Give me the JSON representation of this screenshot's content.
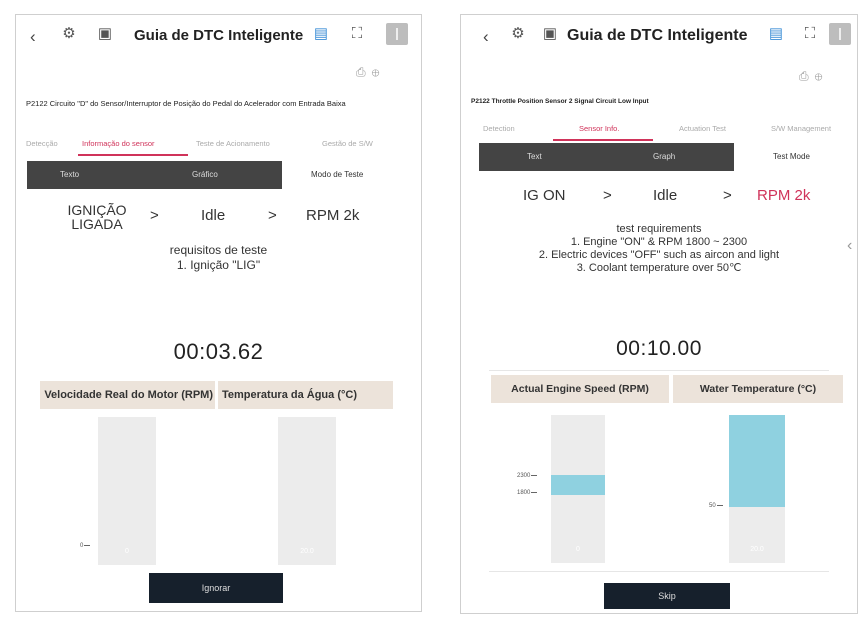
{
  "left": {
    "header": {
      "title": "Guia de DTC Inteligente"
    },
    "dtc_text": "P2122 Circuito \"D\" do Sensor/Interruptor de Posição do Pedal do Acelerador com Entrada Baixa",
    "tabs": [
      "Detecção",
      "Informação do sensor",
      "Teste de Acionamento",
      "Gestão de S/W"
    ],
    "segment": {
      "text": "Texto",
      "graph": "Gráfico",
      "test_mode": "Modo de Teste"
    },
    "steps": [
      "IGNIÇÃO LIGADA",
      ">",
      "Idle",
      ">",
      "RPM 2k"
    ],
    "requirements": {
      "title": "requisitos de teste",
      "lines": [
        "1. Ignição \"LIG\""
      ]
    },
    "timer": "00:03.62",
    "graph_headers": [
      "Velocidade Real do Motor (RPM)",
      "Temperatura da Água (°C)"
    ],
    "graphs": [
      {
        "value_label": "0",
        "tick": "0",
        "fill_fraction": 0
      },
      {
        "value_label": "20.0",
        "fill_fraction": 0
      }
    ],
    "button": "Ignorar"
  },
  "right": {
    "header": {
      "title": "Guia de DTC Inteligente"
    },
    "dtc_text": "P2122 Throttle Position Sensor 2 Signal Circuit Low Input",
    "tabs": [
      "Detection",
      "Sensor Info.",
      "Actuation Test",
      "S/W Management"
    ],
    "segment": {
      "text": "Text",
      "graph": "Graph",
      "test_mode": "Test Mode"
    },
    "steps": [
      "IG ON",
      ">",
      "Idle",
      ">",
      "RPM 2k"
    ],
    "requirements": {
      "title": "test requirements",
      "lines": [
        "1. Engine \"ON\" & RPM 1800 ~ 2300",
        "2. Electric devices \"OFF\" such as aircon and light",
        "3. Coolant temperature over 50℃"
      ]
    },
    "timer": "00:10.00",
    "graph_headers": [
      "Actual Engine Speed (RPM)",
      "Water Temperature (°C)"
    ],
    "graphs": [
      {
        "value_label": "0",
        "ticks": [
          "2300",
          "1800"
        ],
        "band": [
          1800,
          2300
        ]
      },
      {
        "value_label": "20.0",
        "tick": "50",
        "fill_fraction": 0.62
      }
    ],
    "button": "Skip"
  },
  "colors": {
    "accent": "#d0335a",
    "fill": "#8fd1e0",
    "button": "#16202c",
    "segment": "#444444",
    "graph_header": "#ece3da"
  }
}
